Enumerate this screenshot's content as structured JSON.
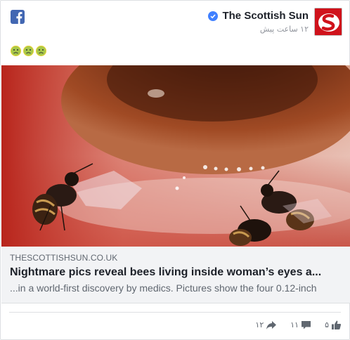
{
  "header": {
    "page_name": "The Scottish Sun",
    "timestamp": "۱۲ ساعت پیش",
    "verified_color": "#4080ff"
  },
  "post": {
    "emoji_count": 3,
    "emoji_icon": "worried-face-icon"
  },
  "link_preview": {
    "domain": "THESCOTTISHSUN.CO.UK",
    "title": "Nightmare pics reveal bees living inside woman’s eyes a...",
    "description": "...in a world-first discovery by medics. Pictures show the four 0.12-inch"
  },
  "footer": {
    "shares": "۱۲",
    "comments": "۱۱",
    "likes": "۵"
  },
  "colors": {
    "facebook_blue": "#4267b2",
    "brand_red": "#d0121b",
    "muted_text": "#606770",
    "link_bg": "#f2f3f5"
  }
}
